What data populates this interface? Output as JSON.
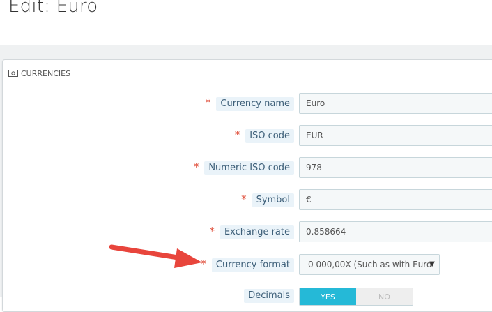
{
  "page": {
    "title": "Edit: Euro"
  },
  "panel": {
    "heading": "CURRENCIES"
  },
  "fields": {
    "currency_name": {
      "label": "Currency name",
      "value": "Euro"
    },
    "iso_code": {
      "label": "ISO code",
      "value": "EUR"
    },
    "numeric_iso_code": {
      "label": "Numeric ISO code",
      "value": "978"
    },
    "symbol": {
      "label": "Symbol",
      "value": "€"
    },
    "exchange_rate": {
      "label": "Exchange rate",
      "value": "0.858664"
    },
    "currency_format": {
      "label": "Currency format",
      "selected": "0 000,00X (Such as with Euro"
    },
    "decimals": {
      "label": "Decimals",
      "yes": "YES",
      "no": "NO",
      "selected": "YES"
    }
  },
  "required_mark": "*",
  "colors": {
    "accent": "#25b9d7",
    "required": "#e04f3b",
    "annotation_arrow": "#e8453c",
    "label_bg": "#eaf3f9"
  },
  "icons": {
    "panel_heading": "money-icon",
    "select": "caret-down-icon",
    "annotation": "red-arrow-annotation"
  }
}
